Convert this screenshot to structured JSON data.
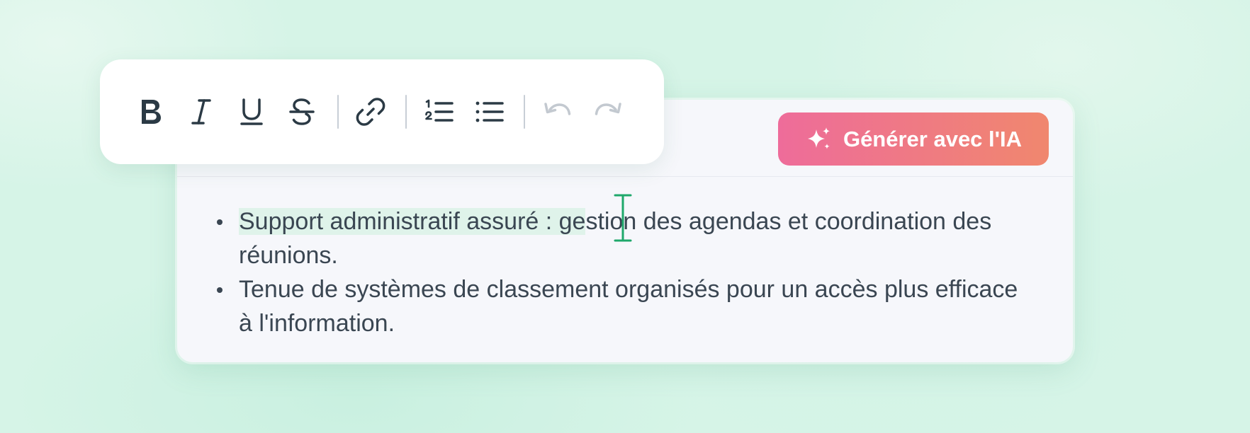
{
  "toolbar": {
    "buttons": [
      {
        "id": "bold",
        "icon": "bold-icon",
        "enabled": true
      },
      {
        "id": "italic",
        "icon": "italic-icon",
        "enabled": true
      },
      {
        "id": "underline",
        "icon": "underline-icon",
        "enabled": true
      },
      {
        "id": "strikethrough",
        "icon": "strikethrough-icon",
        "enabled": true
      },
      {
        "id": "link",
        "icon": "link-icon",
        "enabled": true
      },
      {
        "id": "ordered-list",
        "icon": "ordered-list-icon",
        "enabled": true
      },
      {
        "id": "bullet-list",
        "icon": "bullet-list-icon",
        "enabled": true
      },
      {
        "id": "undo",
        "icon": "undo-icon",
        "enabled": false
      },
      {
        "id": "redo",
        "icon": "redo-icon",
        "enabled": false
      }
    ],
    "icon_color": "#2b3a45",
    "disabled_icon_color": "#c3c9d0"
  },
  "ai_button": {
    "label": "Générer avec l'IA",
    "icon": "sparkle-icon",
    "gradient_start": "#ee6c9a",
    "gradient_end": "#f0876e"
  },
  "content": {
    "items": [
      {
        "highlighted": "Support administratif assuré : ge",
        "rest": "stion des agendas et coordination des réunions."
      },
      {
        "text": "Tenue de systèmes de classement organisés pour un accès plus efficace à l'information."
      }
    ],
    "cursor_color": "#1fa86b"
  }
}
